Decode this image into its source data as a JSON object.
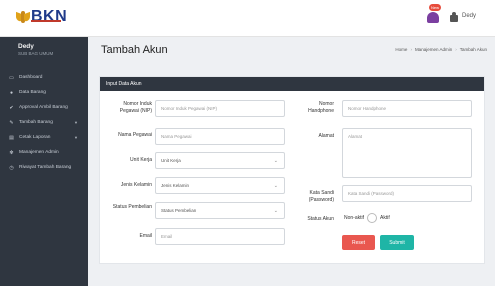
{
  "header": {
    "logo_text": "BKN",
    "notification_badge": "New",
    "user_name": "Dedy"
  },
  "sidebar": {
    "user_name": "Dedy",
    "user_role": "SUB BAG UMUM",
    "items": [
      {
        "label": "Dashboard",
        "icon": "monitor-icon",
        "has_children": false
      },
      {
        "label": "Data Barang",
        "icon": "dot-icon",
        "has_children": false
      },
      {
        "label": "Approval Ambil Barang",
        "icon": "check-icon",
        "has_children": false
      },
      {
        "label": "Tambah Barang",
        "icon": "pencil-icon",
        "has_children": true
      },
      {
        "label": "Cetak Laporan",
        "icon": "printer-icon",
        "has_children": true
      },
      {
        "label": "Manajemen Admin",
        "icon": "gear-icon",
        "has_children": false
      },
      {
        "label": "Riwayat Tambah Barang",
        "icon": "history-icon",
        "has_children": false
      }
    ]
  },
  "page": {
    "title": "Tambah Akun",
    "breadcrumb": [
      "Home",
      "Manajemen Admin",
      "Tambah Akun"
    ]
  },
  "form": {
    "panel_title": "Input Data Akun",
    "nip_label": "Nomor Induk Pegawai (NIP)",
    "nip_placeholder": "Nomor Induk Pegawai (NIP)",
    "nama_label": "Nama Pegawai",
    "nama_placeholder": "Nama Pegawai",
    "unit_label": "Unit Kerja",
    "unit_value": "Unit Kerja",
    "jk_label": "Jenis Kelamin",
    "jk_value": "Jenis Kelamin",
    "status_pemb_label": "Status Pembelian",
    "status_pemb_value": "Status Pembelian",
    "email_label": "Email",
    "email_placeholder": "Email",
    "hp_label": "Nomor Handphone",
    "hp_placeholder": "Nomor Handphone",
    "alamat_label": "Alamat",
    "alamat_placeholder": "Alamat",
    "password_label": "Kata Sandi (Password)",
    "password_placeholder": "Kata Sandi (Password)",
    "status_akun_label": "Status Akun",
    "status_akun_option_1": "Non-aktif",
    "status_akun_option_2": "Aktif",
    "reset_label": "Reset",
    "submit_label": "Submit"
  },
  "colors": {
    "sidebar_bg": "#2f3640",
    "reset_button": "#e9574f",
    "submit_button": "#1fb5a6",
    "logo_blue": "#1f3a8a"
  }
}
